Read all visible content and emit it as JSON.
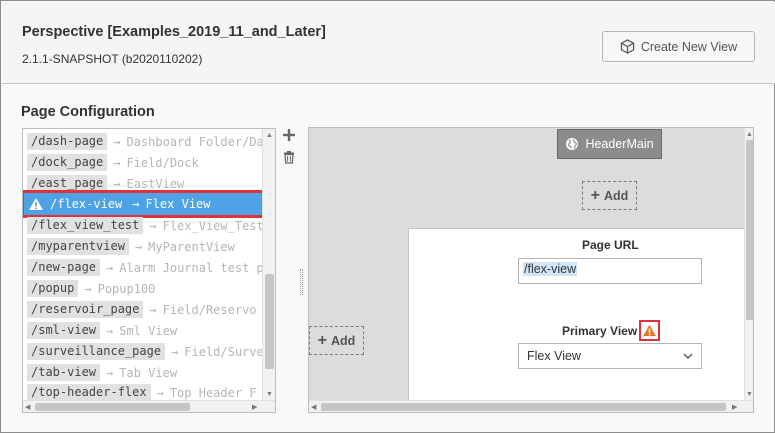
{
  "project": {
    "title": "Perspective [Examples_2019_11_and_Later]",
    "version": "2.1.1-SNAPSHOT (b2020110202)",
    "create_view_label": "Create New View"
  },
  "page_config": {
    "section_title": "Page Configuration",
    "arrow": "→",
    "pages": [
      {
        "path": "/dash-page",
        "view": "Dashboard Folder/Da"
      },
      {
        "path": "/dock_page",
        "view": "Field/Dock"
      },
      {
        "path": "/east_page",
        "view": "EastView"
      },
      {
        "path": "/flex-view",
        "view": "Flex View"
      },
      {
        "path": "/flex_view_test",
        "view": "Flex_View_Test"
      },
      {
        "path": "/myparentview",
        "view": "MyParentView"
      },
      {
        "path": "/new-page",
        "view": "Alarm Journal test p"
      },
      {
        "path": "/popup",
        "view": "Popup100"
      },
      {
        "path": "/reservoir_page",
        "view": "Field/Reservo"
      },
      {
        "path": "/sml-view",
        "view": "Sml View"
      },
      {
        "path": "/surveillance_page",
        "view": "Field/Surve"
      },
      {
        "path": "/tab-view",
        "view": "Tab View"
      },
      {
        "path": "/top-header-flex",
        "view": "Top Header F"
      }
    ],
    "selected_index": 3
  },
  "canvas": {
    "header_label": "HeaderMain",
    "add_label": "Add",
    "page_url_label": "Page URL",
    "page_url_value": "/flex-view",
    "primary_view_label": "Primary View",
    "primary_view_value": "Flex View"
  },
  "colors": {
    "selected_row": "#4da3e6",
    "highlight_outline": "#e0303a",
    "warning_orange": "#e07a28"
  }
}
